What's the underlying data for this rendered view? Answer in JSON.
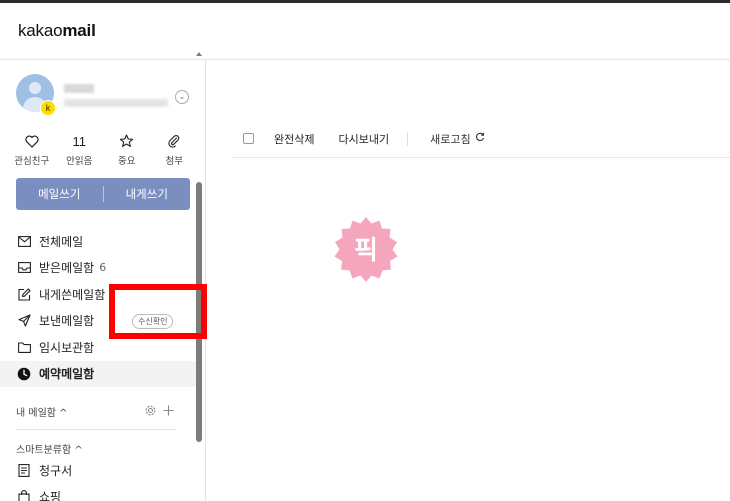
{
  "app": {
    "logo_prefix": "kakao",
    "logo_bold": "mail"
  },
  "account": {
    "badge": "k"
  },
  "quick_menu": [
    {
      "label": "관심친구",
      "icon": "heart-icon",
      "value": ""
    },
    {
      "label": "안읽음",
      "icon": "",
      "value": "11"
    },
    {
      "label": "중요",
      "icon": "star-icon",
      "value": ""
    },
    {
      "label": "첨부",
      "icon": "paperclip-icon",
      "value": ""
    }
  ],
  "compose": {
    "write_mail": "메일쓰기",
    "write_to_me": "내게쓰기",
    "color": "#7a8fc0"
  },
  "folders": [
    {
      "label": "전체메일",
      "icon": "mail-icon",
      "count": ""
    },
    {
      "label": "받은메일함",
      "icon": "inbox-icon",
      "count": "6"
    },
    {
      "label": "내게쓴메일함",
      "icon": "edit-icon",
      "count": ""
    },
    {
      "label": "보낸메일함",
      "icon": "send-icon",
      "count": "",
      "badge": "수신확인"
    },
    {
      "label": "임시보관함",
      "icon": "folder-icon",
      "count": ""
    },
    {
      "label": "예약메일함",
      "icon": "clock-icon",
      "count": "",
      "active": true
    }
  ],
  "my_mailbox": {
    "label": "내 메일함",
    "caret": "^"
  },
  "smart_box": {
    "label": "스마트분류함",
    "caret": "^",
    "items": [
      {
        "label": "청구서",
        "icon": "receipt-icon"
      },
      {
        "label": "쇼핑",
        "icon": "shopping-bag-icon"
      }
    ]
  },
  "toolbar": {
    "delete_all": "완전삭제",
    "resend": "다시보내기",
    "refresh": "새로고침"
  },
  "stamp": {
    "text": "픽",
    "color": "#f497b0"
  },
  "highlight_color": "#ff0000"
}
